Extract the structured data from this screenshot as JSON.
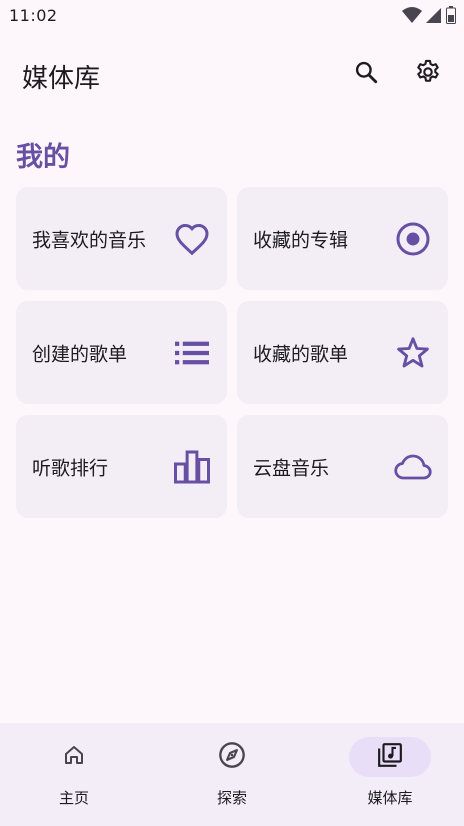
{
  "status_bar": {
    "time": "11:02",
    "icons": [
      "wifi-icon",
      "signal-icon",
      "battery-icon"
    ]
  },
  "app_bar": {
    "title": "媒体库",
    "actions": [
      "search-icon",
      "gear-icon"
    ]
  },
  "section": {
    "title": "我的"
  },
  "cards": [
    {
      "label": "我喜欢的音乐",
      "icon": "heart-icon"
    },
    {
      "label": "收藏的专辑",
      "icon": "album-icon"
    },
    {
      "label": "创建的歌单",
      "icon": "list-icon"
    },
    {
      "label": "收藏的歌单",
      "icon": "star-icon"
    },
    {
      "label": "听歌排行",
      "icon": "bar-chart-icon"
    },
    {
      "label": "云盘音乐",
      "icon": "cloud-icon"
    }
  ],
  "bottom_nav": {
    "items": [
      {
        "label": "主页",
        "icon": "home-icon",
        "active": false
      },
      {
        "label": "探索",
        "icon": "compass-icon",
        "active": false
      },
      {
        "label": "媒体库",
        "icon": "library-music-icon",
        "active": true
      }
    ]
  },
  "colors": {
    "background": "#fdf7fc",
    "accent": "#6750a4",
    "card": "#f3edf6",
    "nav_background": "#f3edf7",
    "nav_active_pill": "#e8def8"
  }
}
